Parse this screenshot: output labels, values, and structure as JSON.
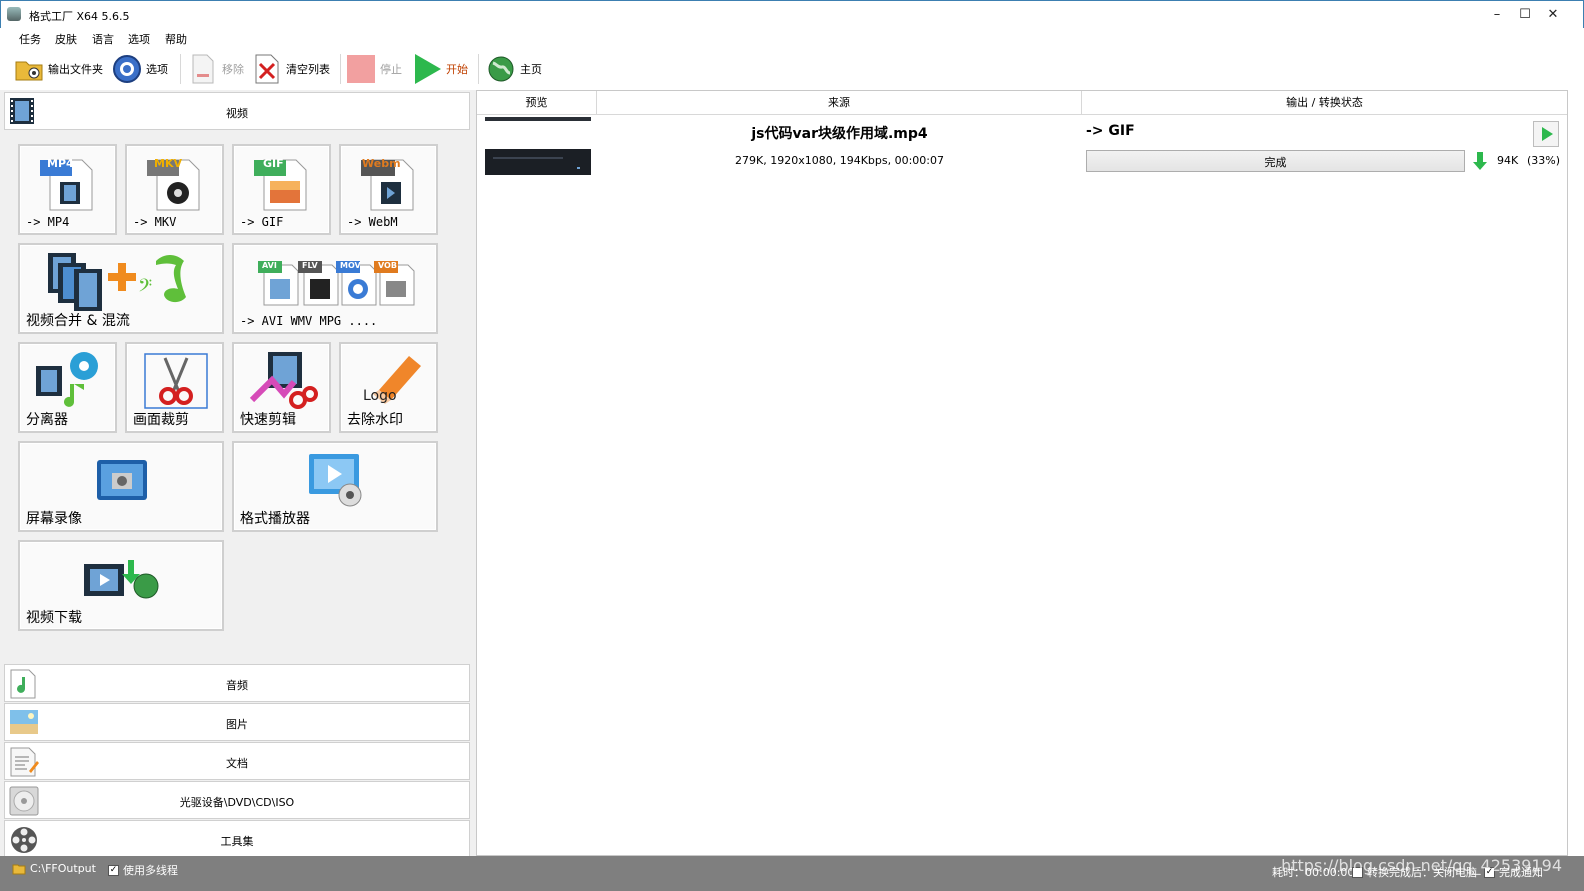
{
  "window": {
    "title": "格式工厂 X64 5.6.5",
    "minimize": "–",
    "maximize": "☐",
    "close": "✕"
  },
  "menu": [
    "任务",
    "皮肤",
    "语言",
    "选项",
    "帮助"
  ],
  "toolbar": {
    "output_folder": "输出文件夹",
    "options": "选项",
    "remove": "移除",
    "clear_list": "清空列表",
    "stop": "停止",
    "start": "开始",
    "home": "主页"
  },
  "categories": {
    "video": "视频",
    "audio": "音频",
    "image": "图片",
    "document": "文档",
    "disc": "光驱设备\\DVD\\CD\\ISO",
    "tools": "工具集"
  },
  "video_tiles": {
    "mp4": {
      "badge": "MP4",
      "label": "-> MP4"
    },
    "mkv": {
      "badge": "MKV",
      "label": "-> MKV"
    },
    "gif": {
      "badge": "GIF",
      "label": "-> GIF"
    },
    "webm": {
      "badge": "Webm",
      "label": "-> WebM"
    },
    "merge": {
      "label": "视频合并 & 混流"
    },
    "multi": {
      "badges": [
        "AVI",
        "FLV",
        "MOV",
        "VOB"
      ],
      "label": "-> AVI WMV MPG ...."
    },
    "splitter": {
      "label": "分离器"
    },
    "crop": {
      "label": "画面裁剪"
    },
    "quick_cut": {
      "label": "快速剪辑"
    },
    "watermark": {
      "label": "去除水印",
      "logo_text": "Logo"
    },
    "screen_record": {
      "label": "屏幕录像"
    },
    "player": {
      "label": "格式播放器"
    },
    "download": {
      "label": "视频下载"
    }
  },
  "columns": {
    "preview": "预览",
    "source": "来源",
    "output": "输出 / 转换状态"
  },
  "task": {
    "filename": "js代码var块级作用域.mp4",
    "info": "279K, 1920x1080, 194Kbps, 00:00:07",
    "target": "-> GIF",
    "status": "完成",
    "progress": 1.0,
    "output_size": "94K",
    "output_ratio": "(33%)"
  },
  "statusbar": {
    "output_path": "C:\\FFOutput",
    "multithread": "使用多线程",
    "elapsed": "耗时：00:00:00",
    "after_convert": "转换完成后：关闭电脑",
    "notify": "完成通知"
  },
  "watermark": "https://blog.csdn.net/qq_42539194",
  "colors": {
    "accent_green": "#2db84d",
    "badge_mp4": "#3a7bd5",
    "badge_mkv": "#d98a2b",
    "badge_gif": "#3fae5b",
    "badge_webm": "#e07b1f"
  }
}
